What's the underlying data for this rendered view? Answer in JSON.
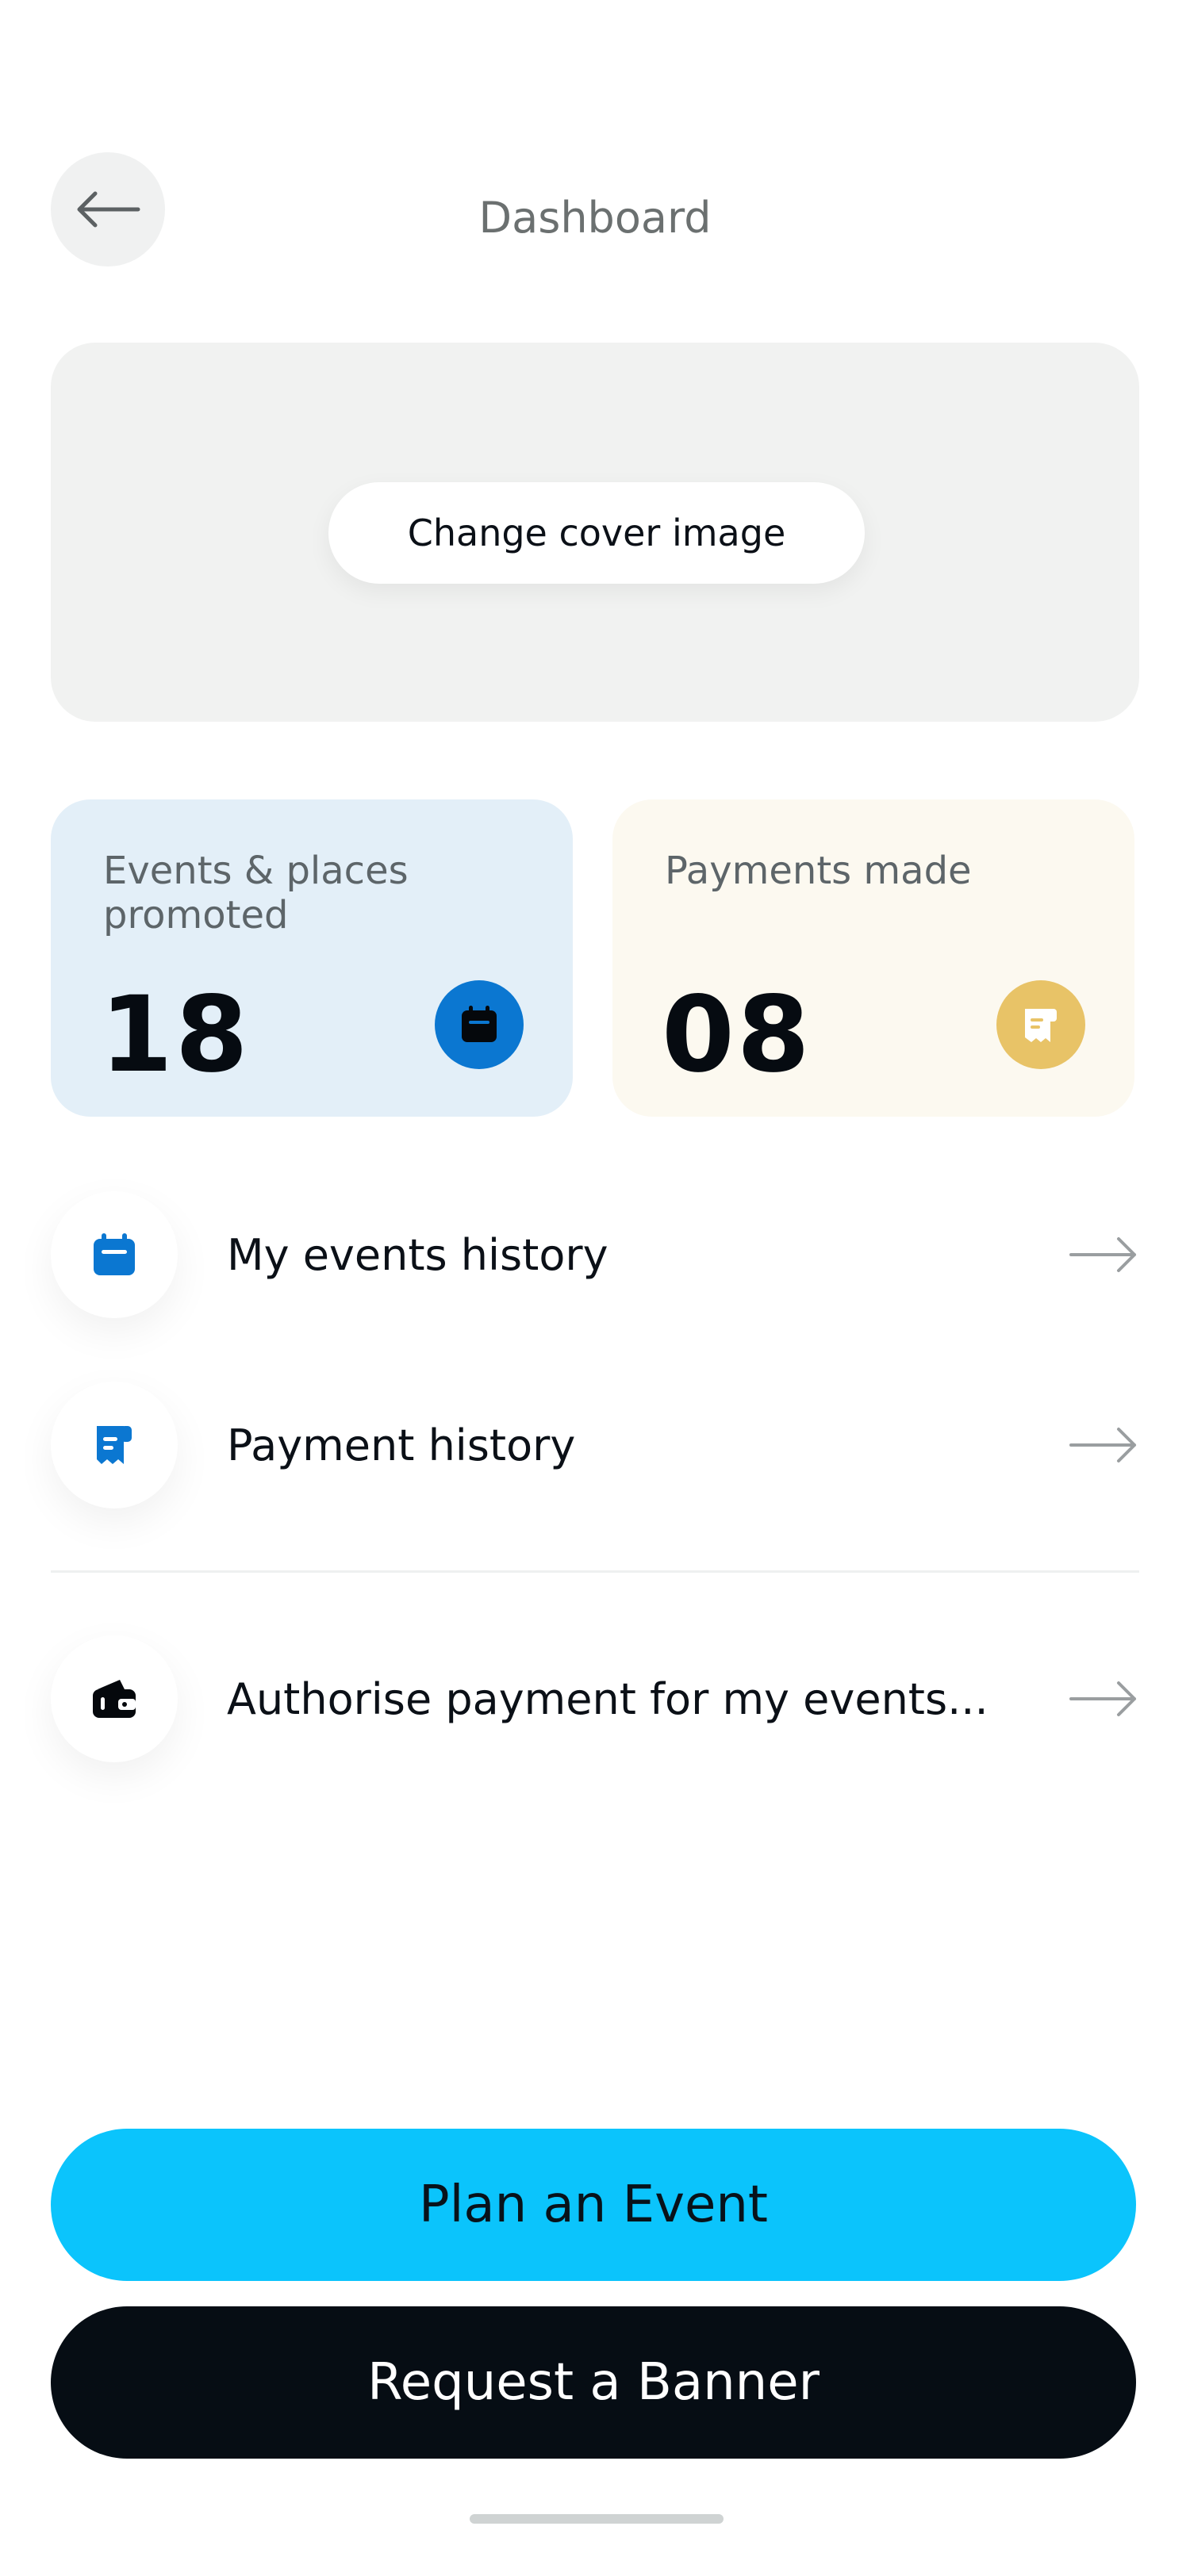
{
  "header": {
    "title": "Dashboard",
    "back_icon": "arrow-left-icon"
  },
  "cover": {
    "button_label": "Change cover image"
  },
  "stats": [
    {
      "label": "Events & places promoted",
      "value": "18",
      "icon": "calendar-icon",
      "color": "#0b77d1",
      "bg": "#e3eff8"
    },
    {
      "label": "Payments made",
      "value": "08",
      "icon": "receipt-icon",
      "color": "#e8c367",
      "bg": "#fcf9f0"
    }
  ],
  "menu": [
    {
      "label": "My events history",
      "icon": "calendar-icon"
    },
    {
      "label": "Payment history",
      "icon": "receipt-icon"
    },
    {
      "label": "Authorise payment for my events...",
      "icon": "wallet-icon"
    }
  ],
  "actions": {
    "primary": "Plan an Event",
    "secondary": "Request a Banner"
  },
  "colors": {
    "accent": "#0bc4fc",
    "dark": "#060d14",
    "brand_blue": "#0b77d1",
    "gold": "#e8c367"
  }
}
